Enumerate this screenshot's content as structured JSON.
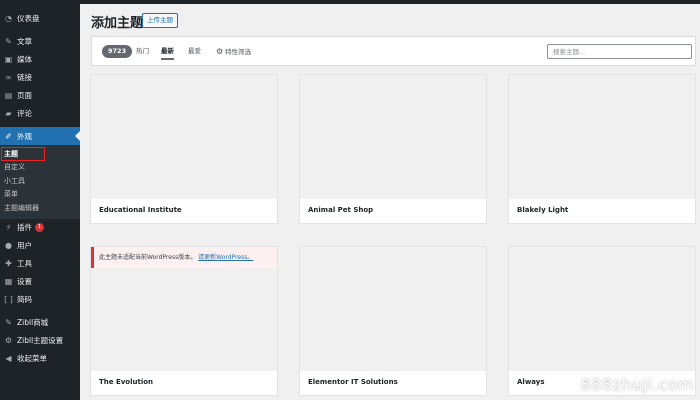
{
  "sidebar": {
    "dashboard": "仪表盘",
    "posts": "文章",
    "media": "媒体",
    "links": "链接",
    "pages": "页面",
    "comments": "评论",
    "appearance": "外观",
    "submenu": [
      "主题",
      "自定义",
      "小工具",
      "菜单",
      "主题编辑器"
    ],
    "plugins": "插件",
    "plugins_badge": "1",
    "users": "用户",
    "tools": "工具",
    "settings": "设置",
    "shortcodes": "简码",
    "zibll_shop": "Zibll商城",
    "zibll_theme_settings": "Zibll主题设置",
    "collapse": "收起菜单"
  },
  "header": {
    "title": "添加主题",
    "upload_button": "上传主题"
  },
  "filter": {
    "count": "9723",
    "tabs": [
      "热门",
      "最新",
      "最爱",
      "特性筛选"
    ],
    "current_tab": "最新",
    "search_placeholder": "搜索主题..."
  },
  "themes": [
    {
      "name": "Educational Institute"
    },
    {
      "name": "Animal Pet Shop"
    },
    {
      "name": "Blakely Light"
    },
    {
      "name": "The Evolution",
      "notice": "此主题未适配当前WordPress版本。",
      "notice_link": "请更新WordPress。"
    },
    {
      "name": "Elementor IT Solutions"
    },
    {
      "name": "Always"
    }
  ],
  "watermark": "888zhuji.com",
  "colors": {
    "sidebar_bg": "#1d2327",
    "accent": "#2271b1",
    "badge": "#d63638"
  }
}
